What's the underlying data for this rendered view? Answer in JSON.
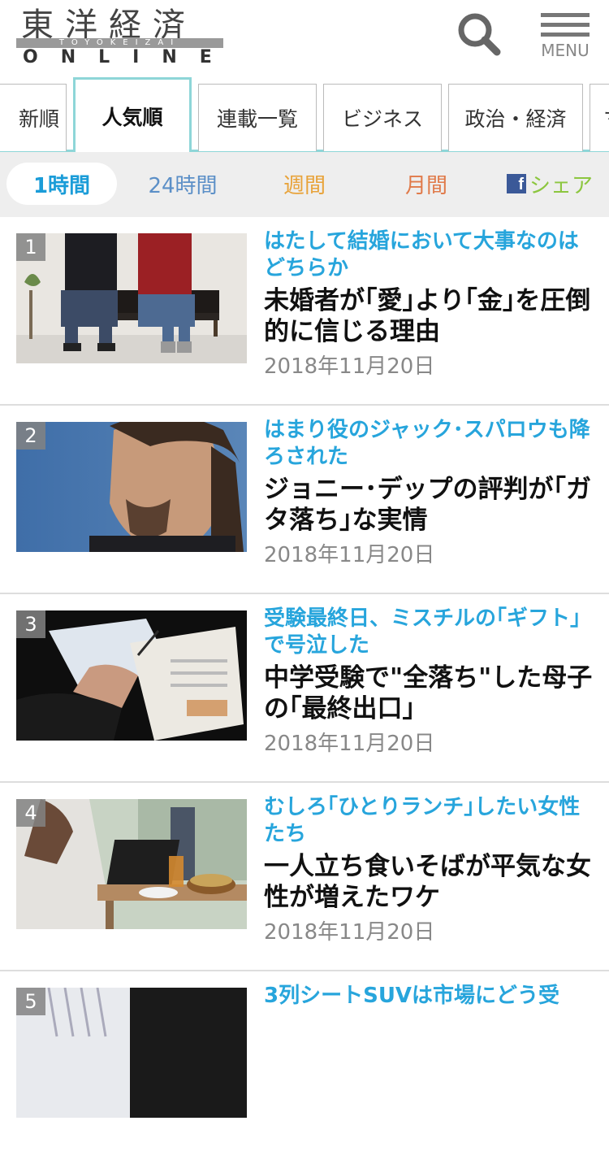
{
  "header": {
    "logo_kanji": "東洋経済",
    "logo_sub": "TOYOKEIZAI",
    "logo_online": "ONLINE",
    "menu_label": "MENU"
  },
  "categories": [
    {
      "label": "新順"
    },
    {
      "label": "人気順"
    },
    {
      "label": "連載一覧"
    },
    {
      "label": "ビジネス"
    },
    {
      "label": "政治・経済"
    },
    {
      "label": "マ"
    }
  ],
  "periods": [
    {
      "label": "1時間",
      "color": "#1a9cd8"
    },
    {
      "label": "24時間",
      "color": "#5b8fc7"
    },
    {
      "label": "週間",
      "color": "#e8a33a"
    },
    {
      "label": "月間",
      "color": "#e07a4a"
    },
    {
      "label": "シェア",
      "color": "#8cc63f"
    }
  ],
  "articles": [
    {
      "rank": "1",
      "subtitle": "はたして結婚において大事なのはどちらか",
      "title": "未婚者が｢愛｣より｢金｣を圧倒的に信じる理由",
      "date": "2018年11月20日"
    },
    {
      "rank": "2",
      "subtitle": "はまり役のジャック･スパロウも降ろされた",
      "title": "ジョニー･デップの評判が｢ガタ落ち｣な実情",
      "date": "2018年11月20日"
    },
    {
      "rank": "3",
      "subtitle": "受験最終日、ミスチルの｢ギフト｣で号泣した",
      "title": "中学受験で\"全落ち\"した母子の｢最終出口｣",
      "date": "2018年11月20日"
    },
    {
      "rank": "4",
      "subtitle": "むしろ｢ひとりランチ｣したい女性たち",
      "title": "一人立ち食いそばが平気な女性が増えたワケ",
      "date": "2018年11月20日"
    },
    {
      "rank": "5",
      "subtitle": "3列シートSUVは市場にどう受",
      "title": "",
      "date": ""
    }
  ]
}
